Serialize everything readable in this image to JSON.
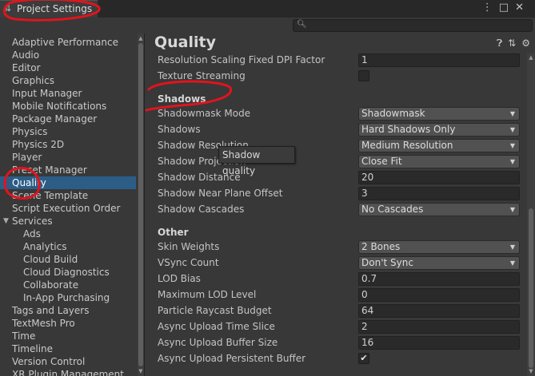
{
  "window": {
    "tab_title": "Project Settings",
    "tab_icon": "settings-sliders-icon",
    "buttons": [
      "⋮",
      "□",
      "✕"
    ]
  },
  "search": {
    "icon": "search-icon",
    "placeholder": ""
  },
  "sidebar": {
    "items": [
      {
        "label": "Adaptive Performance"
      },
      {
        "label": "Audio"
      },
      {
        "label": "Editor"
      },
      {
        "label": "Graphics"
      },
      {
        "label": "Input Manager"
      },
      {
        "label": "Mobile Notifications"
      },
      {
        "label": "Package Manager"
      },
      {
        "label": "Physics"
      },
      {
        "label": "Physics 2D"
      },
      {
        "label": "Player"
      },
      {
        "label": "Preset Manager"
      },
      {
        "label": "Quality",
        "selected": true
      },
      {
        "label": "Scene Template"
      },
      {
        "label": "Script Execution Order"
      },
      {
        "label": "Services",
        "expanded": true
      },
      {
        "label": "Ads",
        "child": true
      },
      {
        "label": "Analytics",
        "child": true
      },
      {
        "label": "Cloud Build",
        "child": true
      },
      {
        "label": "Cloud Diagnostics",
        "child": true
      },
      {
        "label": "Collaborate",
        "child": true
      },
      {
        "label": "In-App Purchasing",
        "child": true
      },
      {
        "label": "Tags and Layers"
      },
      {
        "label": "TextMesh Pro"
      },
      {
        "label": "Time"
      },
      {
        "label": "Timeline"
      },
      {
        "label": "Version Control"
      },
      {
        "label": "XR Plugin Management"
      }
    ]
  },
  "main": {
    "title": "Quality",
    "header_icons": [
      "help-icon",
      "presets-icon",
      "settings-gear-icon"
    ],
    "top_rows": [
      {
        "label": "Resolution Scaling Fixed DPI Factor",
        "type": "field",
        "value": "1"
      },
      {
        "label": "Texture Streaming",
        "type": "checkbox",
        "checked": false
      }
    ],
    "shadows_header": "Shadows",
    "shadow_rows": [
      {
        "label": "Shadowmask Mode",
        "type": "dropdown",
        "value": "Shadowmask"
      },
      {
        "label": "Shadows",
        "type": "dropdown",
        "value": "Hard Shadows Only"
      },
      {
        "label": "Shadow Resolution",
        "type": "dropdown",
        "value": "Medium Resolution"
      },
      {
        "label": "Shadow Projection",
        "type": "dropdown",
        "value": "Close Fit"
      },
      {
        "label": "Shadow Distance",
        "type": "field",
        "value": "20"
      },
      {
        "label": "Shadow Near Plane Offset",
        "type": "field",
        "value": "3"
      },
      {
        "label": "Shadow Cascades",
        "type": "dropdown",
        "value": "No Cascades"
      }
    ],
    "other_header": "Other",
    "other_rows": [
      {
        "label": "Skin Weights",
        "type": "dropdown",
        "value": "2 Bones"
      },
      {
        "label": "VSync Count",
        "type": "dropdown",
        "value": "Don't Sync"
      },
      {
        "label": "LOD Bias",
        "type": "field",
        "value": "0.7"
      },
      {
        "label": "Maximum LOD Level",
        "type": "field",
        "value": "0"
      },
      {
        "label": "Particle Raycast Budget",
        "type": "field",
        "value": "64"
      },
      {
        "label": "Async Upload Time Slice",
        "type": "field",
        "value": "2"
      },
      {
        "label": "Async Upload Buffer Size",
        "type": "field",
        "value": "16"
      },
      {
        "label": "Async Upload Persistent Buffer",
        "type": "checkbox",
        "checked": true
      }
    ],
    "tooltip": "Shadow quality"
  },
  "colors": {
    "accent": "#2c5d87",
    "annotation": "#e0141e"
  }
}
